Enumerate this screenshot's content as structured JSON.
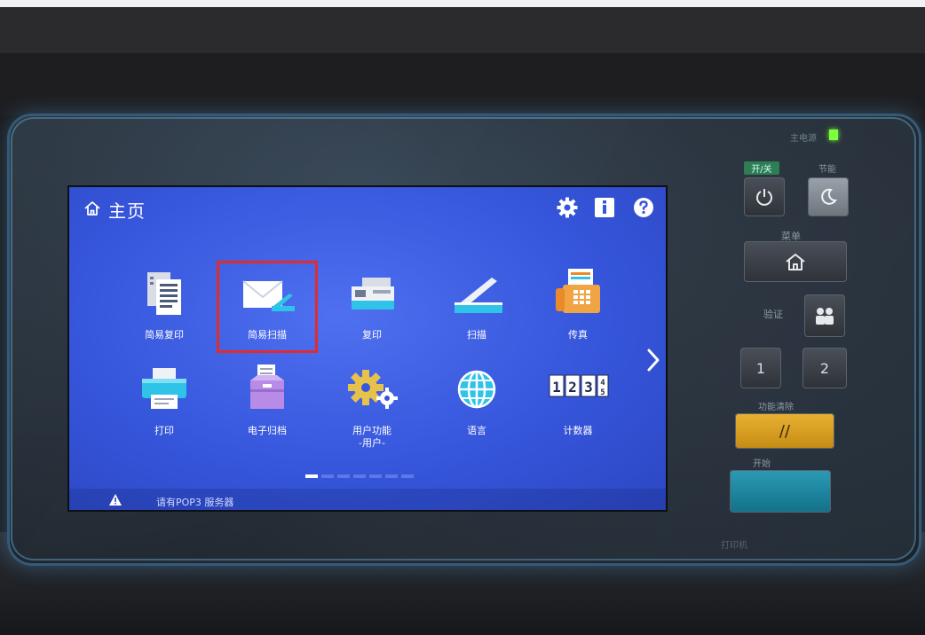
{
  "screen": {
    "header": {
      "title": "主页"
    },
    "tiles": [
      {
        "label": "简易复印",
        "icon": "document-copy-icon"
      },
      {
        "label": "简易扫描",
        "icon": "envelope-scan-icon",
        "highlighted": true
      },
      {
        "label": "复印",
        "icon": "copier-icon"
      },
      {
        "label": "扫描",
        "icon": "scanner-icon"
      },
      {
        "label": "传真",
        "icon": "fax-icon"
      },
      {
        "label": "打印",
        "icon": "printer-icon"
      },
      {
        "label": "电子归档",
        "icon": "box-archive-icon"
      },
      {
        "label": "用户功能\n-用户-",
        "icon": "gears-icon"
      },
      {
        "label": "语言",
        "icon": "globe-icon"
      },
      {
        "label": "计数器",
        "icon": "counter-icon"
      }
    ],
    "counter_digits": [
      "1",
      "2",
      "3",
      "4",
      "5"
    ],
    "pager": {
      "pages": 7,
      "active": 0
    },
    "status": {
      "text": "请有POP3 服务器"
    },
    "colors": {
      "screen": "#3656dc",
      "highlight": "#e22b2b",
      "accent": "#2fc3e8"
    }
  },
  "panel": {
    "main_power_label": "主电源",
    "on_off_label": "开/关",
    "energy_save_label": "节能",
    "menu_label": "菜单",
    "auth_label": "验证",
    "key_1": "1",
    "key_2": "2",
    "reset_label": "功能清除",
    "reset_symbol": "//",
    "start_label": "开始",
    "bottom_label": "打印机"
  }
}
